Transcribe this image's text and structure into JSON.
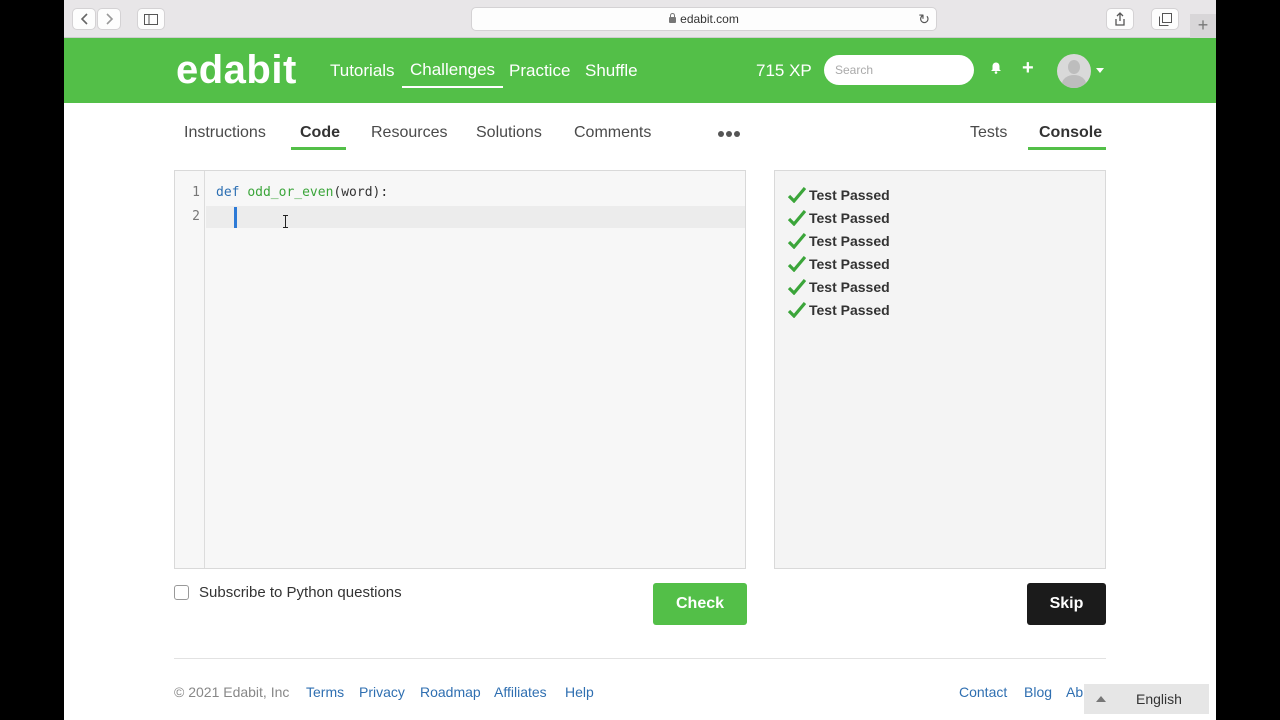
{
  "browser": {
    "url": "edabit.com",
    "new_tab_glyph": "+"
  },
  "header": {
    "logo": "edabit",
    "nav": [
      "Tutorials",
      "Challenges",
      "Practice",
      "Shuffle"
    ],
    "active_nav": "Challenges",
    "xp": "715 XP",
    "search_placeholder": "Search",
    "brand_color": "#53bf48"
  },
  "tabs": {
    "left": [
      "Instructions",
      "Code",
      "Resources",
      "Solutions",
      "Comments"
    ],
    "active_left": "Code",
    "right": [
      "Tests",
      "Console"
    ],
    "active_right": "Console"
  },
  "editor": {
    "line_numbers": [
      "1",
      "2"
    ],
    "line1": {
      "kw": "def",
      "fn": "odd_or_even",
      "rest": "(word):"
    }
  },
  "console": {
    "results": [
      "Test Passed",
      "Test Passed",
      "Test Passed",
      "Test Passed",
      "Test Passed",
      "Test Passed"
    ]
  },
  "actions": {
    "subscribe_label": "Subscribe to Python questions",
    "check_label": "Check",
    "skip_label": "Skip"
  },
  "footer": {
    "copyright": "© 2021 Edabit, Inc",
    "left_links": [
      "Terms",
      "Privacy",
      "Roadmap",
      "Affiliates",
      "Help"
    ],
    "right_links": [
      "Contact",
      "Blog",
      "Ab"
    ],
    "language": "English"
  }
}
